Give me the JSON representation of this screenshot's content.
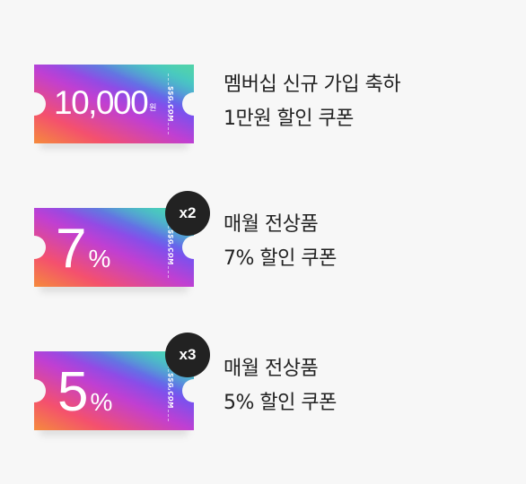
{
  "coupons": [
    {
      "amount": "10,000",
      "unit": "원",
      "brand": "SSG.COM",
      "badge": "",
      "title": "멤버십 신규 가입 축하",
      "subtitle": "1만원 할인 쿠폰"
    },
    {
      "amount": "7",
      "unit": "%",
      "brand": "SSG.COM",
      "badge": "x2",
      "title": "매월 전상품",
      "subtitle": "7% 할인 쿠폰"
    },
    {
      "amount": "5",
      "unit": "%",
      "brand": "SSG.COM",
      "badge": "x3",
      "title": "매월 전상품",
      "subtitle": "5% 할인 쿠폰"
    }
  ]
}
